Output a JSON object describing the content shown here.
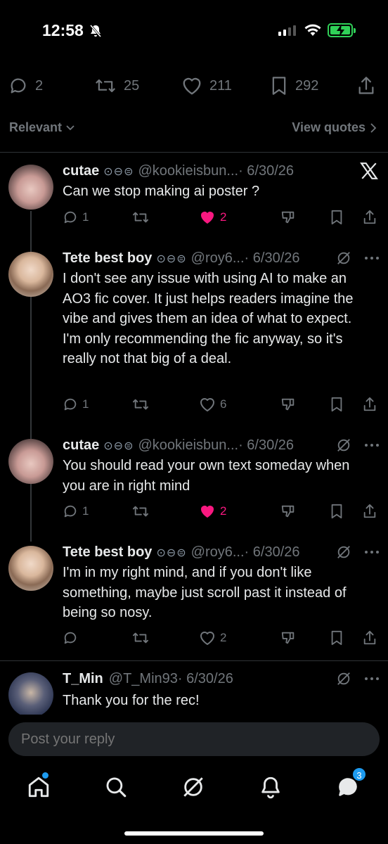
{
  "status_bar": {
    "time": "12:58"
  },
  "tweet_stats": {
    "replies": "2",
    "reposts": "25",
    "likes": "211",
    "bookmarks": "292"
  },
  "filter": {
    "sort_label": "Relevant",
    "view_quotes_label": "View quotes"
  },
  "replies": [
    {
      "name": "cutae",
      "badges": "⊙⊖⊜",
      "handle": "@kookieisbun...",
      "date": "· 6/30/26",
      "text": "Can we stop making ai poster ?",
      "reply_count": "1",
      "repost_count": "",
      "like_count": "2",
      "liked": true
    },
    {
      "name": "Tete best boy",
      "badges": "⊙⊖⊜",
      "handle": "@roy6...",
      "date": "· 6/30/26",
      "text": "I don't see any issue with using AI to make an AO3 fic cover. It just helps readers imagine the vibe and gives them an idea of what to expect. I'm only recommending the fic anyway, so it's really not that big of a deal.",
      "reply_count": "1",
      "repost_count": "",
      "like_count": "6",
      "liked": false
    },
    {
      "name": "cutae",
      "badges": "⊙⊖⊜",
      "handle": "@kookieisbun...",
      "date": "· 6/30/26",
      "text": "You should read your own text someday when you are in right mind",
      "reply_count": "1",
      "repost_count": "",
      "like_count": "2",
      "liked": true
    },
    {
      "name": "Tete best boy",
      "badges": "⊙⊖⊜",
      "handle": "@roy6...",
      "date": "· 6/30/26",
      "text": "I'm in my right mind, and if you don't like something, maybe just scroll past it instead of being so nosy.",
      "reply_count": "",
      "repost_count": "",
      "like_count": "2",
      "liked": false
    },
    {
      "name": "T_Min",
      "badges": "",
      "handle": "@T_Min93",
      "date": "· 6/30/26",
      "text": "Thank you for the rec!"
    }
  ],
  "reply_bar": {
    "placeholder": "Post your reply"
  },
  "bottom_nav": {
    "messages_badge": "3"
  },
  "colors": {
    "background": "#000000",
    "like_pink": "#f91880",
    "accent_blue": "#1d9bf0",
    "muted": "#71767b",
    "battery_green": "#30d158"
  },
  "icons": [
    "bell-off-icon",
    "signal-icon",
    "wifi-icon",
    "battery-icon",
    "reply-icon",
    "repost-icon",
    "heart-icon",
    "bookmark-icon",
    "share-icon",
    "chevron-down-icon",
    "chevron-right-icon",
    "x-logo-icon",
    "grok-icon",
    "more-icon",
    "dislike-icon",
    "home-icon",
    "search-icon",
    "bell-icon",
    "messages-icon"
  ]
}
